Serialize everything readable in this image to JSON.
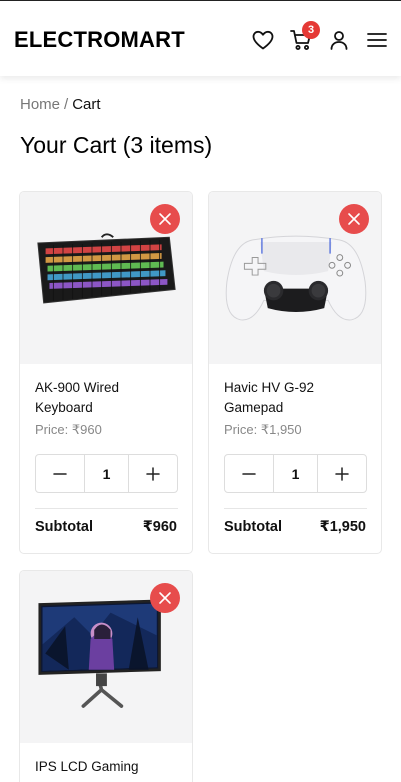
{
  "brand": "ELECTROMART",
  "header": {
    "cart_count": "3",
    "icons": [
      "heart-icon",
      "cart-icon",
      "user-icon",
      "menu-icon"
    ]
  },
  "breadcrumb": {
    "home": "Home",
    "separator": "/",
    "current": "Cart"
  },
  "page_title": "Your Cart (3 items)",
  "colors": {
    "accent": "#e74c4c",
    "badge": "#e53935",
    "image_bg": "#f4f4f5"
  },
  "cart": {
    "items": [
      {
        "name": "AK-900 Wired Keyboard",
        "price": "Price: ₹960",
        "quantity": "1",
        "subtotal_label": "Subtotal",
        "subtotal": "₹960"
      },
      {
        "name": "Havic HV G-92 Gamepad",
        "price": "Price: ₹1,950",
        "quantity": "1",
        "subtotal_label": "Subtotal",
        "subtotal": "₹1,950"
      },
      {
        "name": "IPS LCD Gaming"
      }
    ]
  }
}
